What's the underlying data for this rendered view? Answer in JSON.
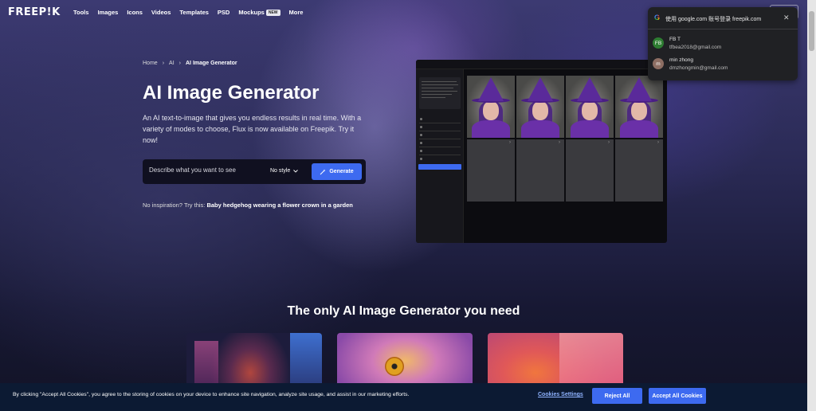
{
  "nav": {
    "logo": "FREEP!K",
    "items": [
      "Tools",
      "Images",
      "Icons",
      "Videos",
      "Templates",
      "PSD",
      "Mockups",
      "More"
    ],
    "mockups_badge": "NEW"
  },
  "breadcrumb": [
    "Home",
    "AI",
    "AI Image Generator"
  ],
  "hero": {
    "title": "AI Image Generator",
    "subtitle": "An AI text-to-image that gives you endless results in real time. With a variety of modes to choose, Flux is now available on Freepik. Try it now!",
    "prompt_placeholder": "Describe what you want to see",
    "style_value": "No style",
    "generate_label": "Generate",
    "inspiration_prefix": "No inspiration? Try this:",
    "inspiration_text": "Baby hedgehog wearing a flower crown in a garden"
  },
  "google_popup": {
    "title": "使用 google.com 账号登录 freepik.com",
    "accounts": [
      {
        "initials": "FB",
        "name": "FB T",
        "email": "tfbea2018@gmail.com",
        "color": "#2e7d32"
      },
      {
        "initials": "m",
        "name": "min zhong",
        "email": "dmzhongmin@gmail.com",
        "color": "#8d6e63"
      }
    ]
  },
  "section": {
    "title": "The only AI Image Generator you need"
  },
  "cookie": {
    "text": "By clicking \"Accept All Cookies\", you agree to the storing of cookies on your device to enhance site navigation, analyze site usage, and assist in our marketing efforts.",
    "settings_label": "Cookies Settings",
    "reject_label": "Reject All",
    "accept_label": "Accept All Cookies"
  },
  "colors": {
    "accent": "#3d6af0",
    "cookie_bg": "#0c1a33",
    "popup_bg": "#202124"
  }
}
